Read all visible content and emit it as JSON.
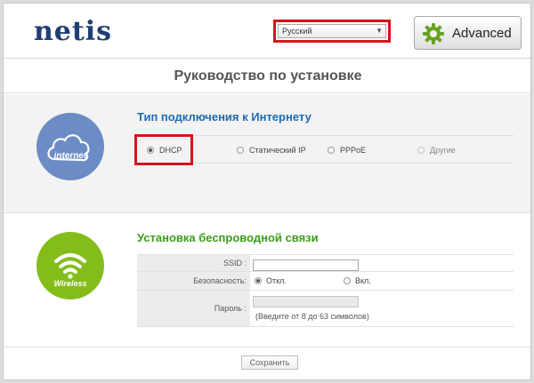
{
  "header": {
    "logo": "netis",
    "language_selected": "Русский",
    "advanced_label": "Advanced"
  },
  "page_title": "Руководство по установке",
  "internet": {
    "icon_label": "internet",
    "section_title": "Тип подключения к Интернету",
    "options": [
      {
        "label": "DHCP",
        "checked": true,
        "disabled": false
      },
      {
        "label": "Статический IP",
        "checked": false,
        "disabled": false
      },
      {
        "label": "PPPoE",
        "checked": false,
        "disabled": false
      },
      {
        "label": "Другие",
        "checked": false,
        "disabled": true
      }
    ]
  },
  "wireless": {
    "icon_label": "Wireless",
    "section_title": "Установка беспроводной связи",
    "ssid_label": "SSID :",
    "ssid_value": "",
    "security_label": "Безопасность:",
    "security_off": "Откл.",
    "security_on": "Вкл.",
    "password_label": "Пароль :",
    "password_value": "",
    "password_hint": "(Введите от 8 до 63 символов)"
  },
  "save_label": "Сохранить",
  "colors": {
    "logo": "#1f3f73",
    "highlight": "#d4141c",
    "internet_circle": "#6b8cc4",
    "wireless_circle": "#84bd1b",
    "internet_title": "#1d6bb3",
    "wireless_title": "#3a9d1b",
    "gear": "#6aa321"
  },
  "icons": {
    "advanced": "gear-icon",
    "internet": "cloud-icon",
    "wireless": "wifi-icon",
    "dropdown": "chevron-down-icon"
  }
}
